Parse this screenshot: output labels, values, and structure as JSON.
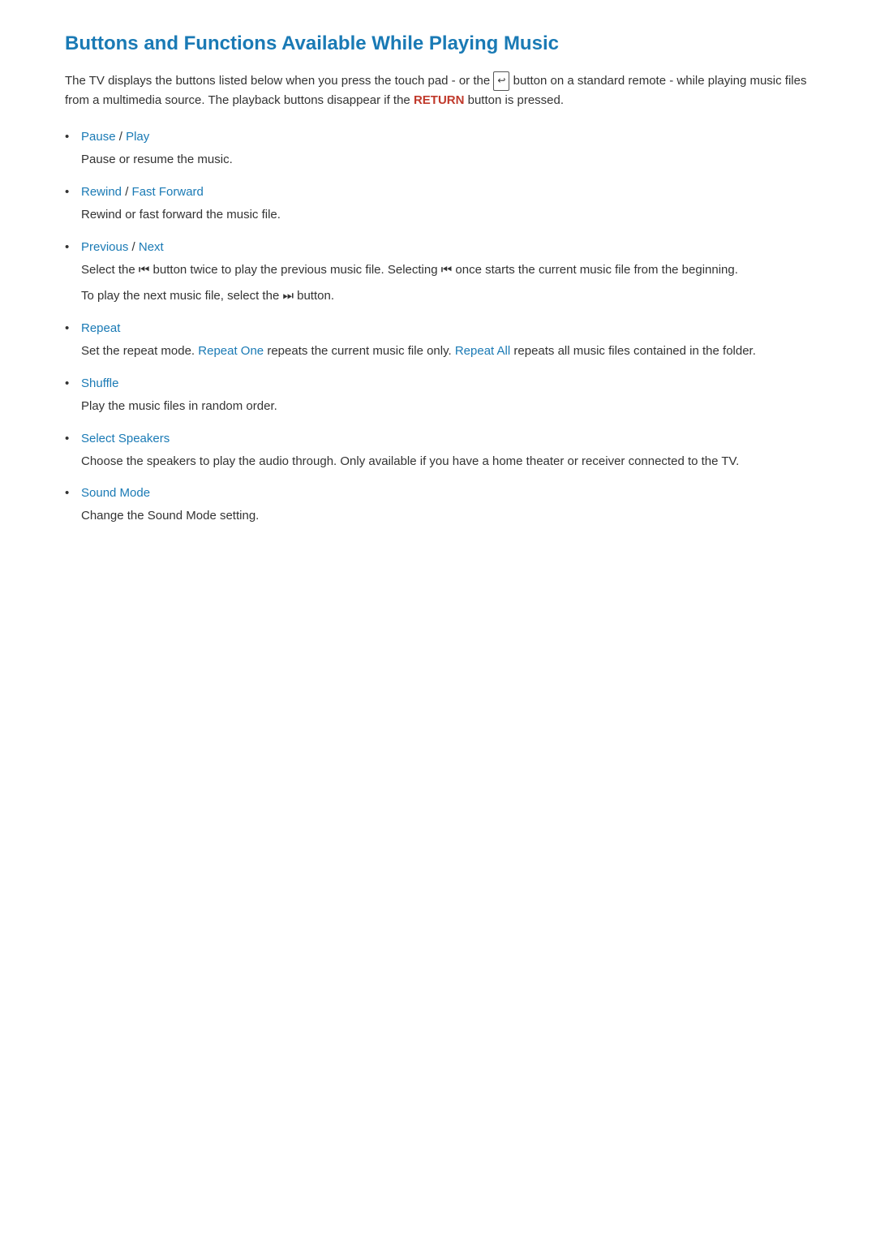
{
  "page": {
    "title": "Buttons and Functions Available While Playing Music",
    "intro": {
      "text_before": "The TV displays the buttons listed below when you press the touch pad - or the",
      "icon_label": "⬛→",
      "text_after": "button on a standard remote - while playing music files from a multimedia source. The playback buttons disappear if the",
      "return_label": "RETURN",
      "text_end": "button is pressed."
    },
    "items": [
      {
        "id": "pause-play",
        "title_parts": [
          "Pause",
          " / ",
          "Play"
        ],
        "title_colors": [
          "link",
          "plain",
          "link"
        ],
        "description": [
          "Pause or resume the music."
        ]
      },
      {
        "id": "rewind-fastforward",
        "title_parts": [
          "Rewind",
          " / ",
          "Fast Forward"
        ],
        "title_colors": [
          "link",
          "plain",
          "link"
        ],
        "description": [
          "Rewind or fast forward the music file."
        ]
      },
      {
        "id": "previous-next",
        "title_parts": [
          "Previous",
          " / ",
          "Next"
        ],
        "title_colors": [
          "link",
          "plain",
          "link"
        ],
        "description": [
          "Select the ⏮ button twice to play the previous music file. Selecting ⏮ once starts the current music file from the beginning.",
          "To play the next music file, select the ⏭ button."
        ]
      },
      {
        "id": "repeat",
        "title_parts": [
          "Repeat"
        ],
        "title_colors": [
          "link"
        ],
        "description_complex": true,
        "description": [
          "Set the repeat mode. Repeat One repeats the current music file only. Repeat All repeats all music files contained in the folder."
        ],
        "highlights": [
          "Repeat One",
          "Repeat All"
        ]
      },
      {
        "id": "shuffle",
        "title_parts": [
          "Shuffle"
        ],
        "title_colors": [
          "link"
        ],
        "description": [
          "Play the music files in random order."
        ]
      },
      {
        "id": "select-speakers",
        "title_parts": [
          "Select Speakers"
        ],
        "title_colors": [
          "link"
        ],
        "description": [
          "Choose the speakers to play the audio through. Only available if you have a home theater or receiver connected to the TV."
        ]
      },
      {
        "id": "sound-mode",
        "title_parts": [
          "Sound Mode"
        ],
        "title_colors": [
          "link"
        ],
        "description": [
          "Change the Sound Mode setting."
        ]
      }
    ]
  }
}
